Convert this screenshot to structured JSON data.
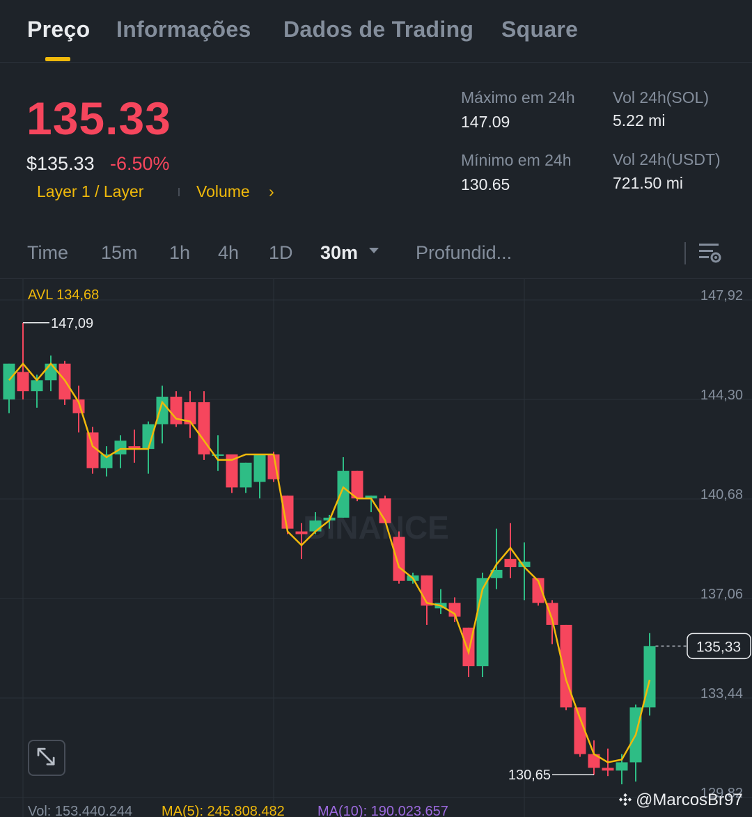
{
  "tabs": [
    {
      "label": "Preço",
      "active": true
    },
    {
      "label": "Informações",
      "active": false
    },
    {
      "label": "Dados de Trading",
      "active": false
    },
    {
      "label": "Square",
      "active": false
    }
  ],
  "price": {
    "last": "135.33",
    "usd": "$135.33",
    "change_pct": "-6.50%",
    "tag_category": "Layer 1 / Layer",
    "tag_volume": "Volume",
    "chevron": "›"
  },
  "stats": {
    "high_label": "Máximo em 24h",
    "high_value": "147.09",
    "low_label": "Mínimo em 24h",
    "low_value": "130.65",
    "vol_base_label": "Vol 24h(SOL)",
    "vol_base_value": "5.22 mi",
    "vol_quote_label": "Vol 24h(USDT)",
    "vol_quote_value": "721.50 mi"
  },
  "intervals": [
    {
      "label": "Time",
      "active": false
    },
    {
      "label": "15m",
      "active": false
    },
    {
      "label": "1h",
      "active": false
    },
    {
      "label": "4h",
      "active": false
    },
    {
      "label": "1D",
      "active": false
    },
    {
      "label": "30m",
      "active": true
    },
    {
      "label": "Profundid...",
      "active": false
    }
  ],
  "icons": {
    "dropdown": "caret-down-icon",
    "settings": "chart-settings-icon",
    "expand": "expand-arrows-icon",
    "brand": "binance-diamond-icon"
  },
  "colors": {
    "up": "#2ebd85",
    "down": "#f6465d",
    "accent": "#f0b90b",
    "ma_line": "#f0b90b",
    "grid": "#2b3139",
    "axis_text": "#848e9c"
  },
  "chart_data": {
    "type": "candlestick",
    "avl_label": "AVL 134,68",
    "y_ticks": [
      "147,92",
      "144,30",
      "140,68",
      "137,06",
      "133,44",
      "129,82"
    ],
    "y_tick_values": [
      147.92,
      144.3,
      140.68,
      137.06,
      133.44,
      129.82
    ],
    "ylim": [
      128.5,
      148.3
    ],
    "last_price_label": "135,33",
    "last_price": 135.33,
    "high_marker": {
      "label": "147,09",
      "value": 147.09,
      "index": 1
    },
    "low_marker": {
      "label": "130,65",
      "value": 130.65,
      "index": 42
    },
    "watermark": "BINANCE",
    "candles": [
      {
        "o": 144.3,
        "h": 145.0,
        "l": 143.8,
        "c": 145.6
      },
      {
        "o": 145.3,
        "h": 147.09,
        "l": 144.3,
        "c": 144.6
      },
      {
        "o": 144.6,
        "h": 145.2,
        "l": 144.0,
        "c": 145.0
      },
      {
        "o": 145.0,
        "h": 145.9,
        "l": 144.6,
        "c": 145.6
      },
      {
        "o": 145.6,
        "h": 145.7,
        "l": 144.1,
        "c": 144.3
      },
      {
        "o": 144.3,
        "h": 144.8,
        "l": 143.1,
        "c": 143.8
      },
      {
        "o": 143.1,
        "h": 143.3,
        "l": 141.6,
        "c": 141.8
      },
      {
        "o": 141.8,
        "h": 142.6,
        "l": 141.5,
        "c": 142.3
      },
      {
        "o": 142.3,
        "h": 143.0,
        "l": 141.8,
        "c": 142.8
      },
      {
        "o": 142.6,
        "h": 143.2,
        "l": 142.0,
        "c": 142.5
      },
      {
        "o": 142.5,
        "h": 143.5,
        "l": 141.6,
        "c": 143.4
      },
      {
        "o": 143.4,
        "h": 144.8,
        "l": 142.7,
        "c": 144.4
      },
      {
        "o": 144.4,
        "h": 144.6,
        "l": 143.3,
        "c": 143.4
      },
      {
        "o": 144.2,
        "h": 144.6,
        "l": 142.9,
        "c": 143.4
      },
      {
        "o": 144.2,
        "h": 144.6,
        "l": 142.1,
        "c": 142.3
      },
      {
        "o": 142.3,
        "h": 143.0,
        "l": 141.7,
        "c": 142.3
      },
      {
        "o": 142.3,
        "h": 142.3,
        "l": 140.9,
        "c": 141.1
      },
      {
        "o": 141.1,
        "h": 142.0,
        "l": 140.9,
        "c": 142.0
      },
      {
        "o": 141.3,
        "h": 142.3,
        "l": 140.7,
        "c": 142.3
      },
      {
        "o": 142.3,
        "h": 142.4,
        "l": 141.3,
        "c": 141.4
      },
      {
        "o": 140.8,
        "h": 140.8,
        "l": 139.4,
        "c": 139.6
      },
      {
        "o": 139.5,
        "h": 139.8,
        "l": 138.5,
        "c": 139.4
      },
      {
        "o": 139.5,
        "h": 140.2,
        "l": 139.4,
        "c": 139.9
      },
      {
        "o": 139.9,
        "h": 140.1,
        "l": 139.6,
        "c": 140.0
      },
      {
        "o": 140.0,
        "h": 142.2,
        "l": 140.0,
        "c": 141.7
      },
      {
        "o": 141.7,
        "h": 141.7,
        "l": 140.6,
        "c": 140.7
      },
      {
        "o": 140.7,
        "h": 140.8,
        "l": 140.2,
        "c": 140.8
      },
      {
        "o": 140.7,
        "h": 140.8,
        "l": 139.8,
        "c": 139.8
      },
      {
        "o": 139.3,
        "h": 139.5,
        "l": 137.6,
        "c": 137.7
      },
      {
        "o": 137.7,
        "h": 138.0,
        "l": 137.6,
        "c": 137.9
      },
      {
        "o": 137.9,
        "h": 137.9,
        "l": 136.1,
        "c": 136.8
      },
      {
        "o": 136.7,
        "h": 137.4,
        "l": 136.5,
        "c": 136.9
      },
      {
        "o": 136.9,
        "h": 137.1,
        "l": 136.2,
        "c": 136.4
      },
      {
        "o": 136.0,
        "h": 136.0,
        "l": 134.2,
        "c": 134.6
      },
      {
        "o": 134.6,
        "h": 138.0,
        "l": 134.2,
        "c": 137.8
      },
      {
        "o": 137.8,
        "h": 139.6,
        "l": 137.4,
        "c": 138.1
      },
      {
        "o": 138.5,
        "h": 139.8,
        "l": 137.8,
        "c": 138.2
      },
      {
        "o": 138.2,
        "h": 139.1,
        "l": 137.0,
        "c": 138.4
      },
      {
        "o": 137.8,
        "h": 137.8,
        "l": 136.8,
        "c": 136.9
      },
      {
        "o": 136.9,
        "h": 137.0,
        "l": 135.4,
        "c": 136.1
      },
      {
        "o": 136.1,
        "h": 136.1,
        "l": 133.0,
        "c": 133.1
      },
      {
        "o": 133.1,
        "h": 133.1,
        "l": 131.3,
        "c": 131.4
      },
      {
        "o": 131.4,
        "h": 131.9,
        "l": 130.65,
        "c": 130.9
      },
      {
        "o": 130.9,
        "h": 131.6,
        "l": 130.6,
        "c": 130.8
      },
      {
        "o": 130.8,
        "h": 131.4,
        "l": 130.3,
        "c": 131.1
      },
      {
        "o": 131.1,
        "h": 133.2,
        "l": 130.4,
        "c": 133.1
      },
      {
        "o": 133.1,
        "h": 135.8,
        "l": 132.8,
        "c": 135.33
      }
    ],
    "ma": [
      145.0,
      145.6,
      145.0,
      145.6,
      145.0,
      144.2,
      142.6,
      142.2,
      142.5,
      142.5,
      142.5,
      144.2,
      143.6,
      143.5,
      142.8,
      142.1,
      142.1,
      142.3,
      142.3,
      142.3,
      139.5,
      139.0,
      139.5,
      139.9,
      141.1,
      140.7,
      140.7,
      139.9,
      138.2,
      137.8,
      136.9,
      136.8,
      136.5,
      135.1,
      137.4,
      138.3,
      138.9,
      138.2,
      137.7,
      136.3,
      134.1,
      132.7,
      131.4,
      131.1,
      131.2,
      132.1,
      134.1
    ]
  },
  "volume_row": {
    "vol": "Vol: 153.440.244",
    "ma5": "MA(5): 245.808.482",
    "ma10": "MA(10): 190.023.657"
  },
  "watermark_user": "@MarcosBr97"
}
